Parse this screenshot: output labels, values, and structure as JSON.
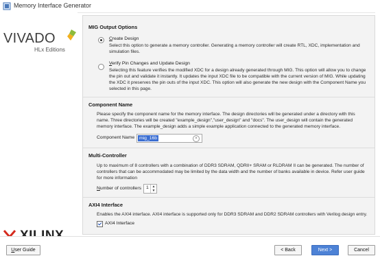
{
  "window": {
    "title": "Memory Interface Generator"
  },
  "brand": {
    "vivado": "VIVADO",
    "edition": "HLx Editions",
    "xilinx": "XILINX"
  },
  "mig_output": {
    "heading": "MIG Output Options",
    "create": {
      "label": "Create Design",
      "desc": [
        "Select this option to generate a memory controller. Generating a memory controller will create RTL, XDC, implementation and",
        "simulation files."
      ]
    },
    "verify": {
      "label": "Verify Pin Changes and Update Design",
      "desc": [
        "Selecting this feature verifies the modified XDC for a design already generated through MIG. This option will allow you to change",
        "the pin out and validate it instantly. It updates the input XDC file to be compatible with the current version of MIG. While updating",
        "the XDC it preserves the pin outs of the input XDC. This option will also generate the new design with the Component Name you",
        "selected in this page."
      ]
    }
  },
  "component": {
    "heading": "Component Name",
    "desc": [
      "Please specify the component name for the memory interface. The design directories will be generated under a directory with this",
      "name. Three directories will be created \"example_design\",\"user_design\" and \"docs\". The user_design will contain the generated",
      "memory interface. The example_design adds a simple example application connected to the generated memory interface."
    ],
    "field_label": "Component Name",
    "value": "mig_16b"
  },
  "multi": {
    "heading": "Multi-Controller",
    "desc": [
      "Up to maximum of 8 controllers with a combination of DDR3 SDRAM, QDRII+ SRAM or RLDRAM II can be generated. The number of",
      "controllers that can be accommodated may be limited by the data width and the number of banks available in device. Refer user guide",
      "for more information"
    ],
    "field_label": "Number of controllers",
    "value": "1"
  },
  "axi": {
    "heading": "AXI4 Interface",
    "desc": "Enables the AXI4 interface. AXI4 interface is supported only for DDR3 SDRAM and DDR2 SDRAM controllers with Verilog design entry.",
    "checkbox_label": "AXI4 Interface"
  },
  "buttons": {
    "user_guide": "User Guide",
    "back": "< Back",
    "next": "Next >",
    "cancel": "Cancel"
  },
  "colors": {
    "accent": "#4d82d6",
    "selection": "#3b6ed2",
    "vivado_leaf": "#8dbb3c",
    "xilinx_red": "#d52b1e"
  }
}
